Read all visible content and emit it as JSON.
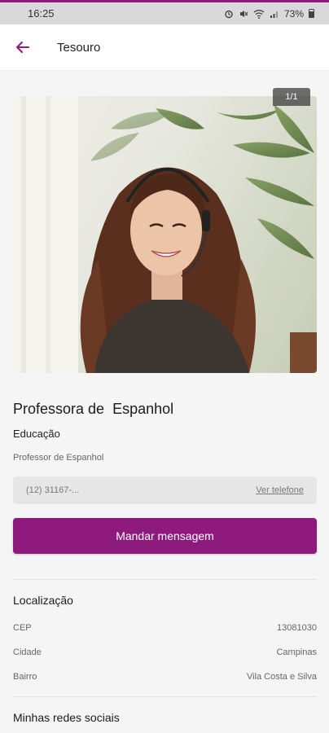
{
  "status_bar": {
    "time": "16:25",
    "battery": "73%"
  },
  "app_bar": {
    "title": "Tesouro"
  },
  "photo": {
    "counter": "1/1"
  },
  "listing": {
    "title": "Professora de  Espanhol",
    "category": "Educação",
    "subtitle": "Professor de Espanhol"
  },
  "contact": {
    "phone_masked": "(12) 31167-...",
    "see_phone_label": "Ver telefone",
    "message_button": "Mandar mensagem"
  },
  "location": {
    "heading": "Localização",
    "rows": [
      {
        "label": "CEP",
        "value": "13081030"
      },
      {
        "label": "Cidade",
        "value": "Campinas"
      },
      {
        "label": "Bairro",
        "value": "Vila Costa e Silva"
      }
    ]
  },
  "social": {
    "heading": "Minhas redes sociais"
  },
  "colors": {
    "accent": "#8e1a7e",
    "background": "#f5f5f5"
  }
}
